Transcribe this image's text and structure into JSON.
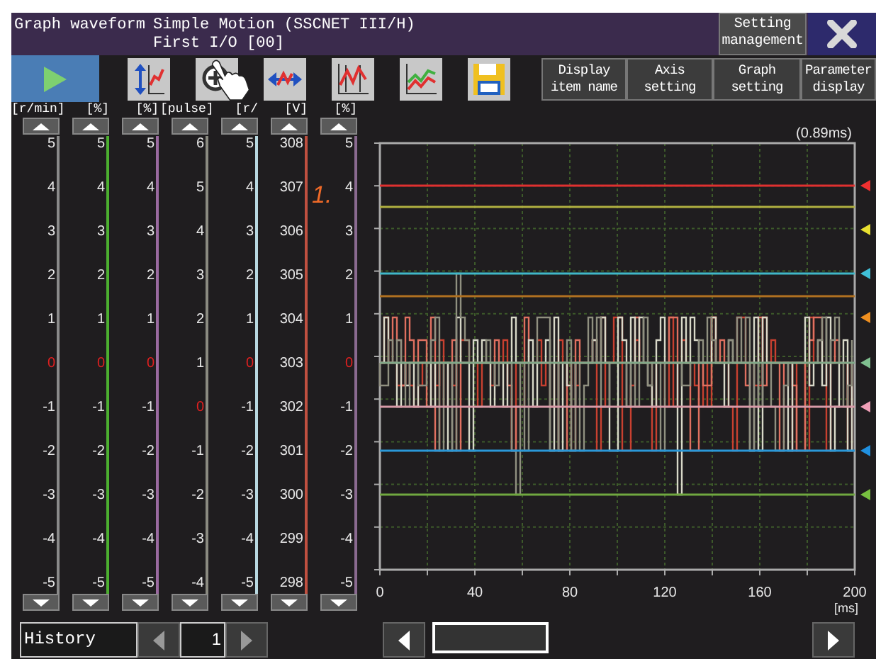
{
  "title_bar": {
    "title": "Graph waveform",
    "subtitle_lines": [
      "Simple Motion (SSCNET III/H)",
      "First I/O [00]"
    ],
    "setting_button": "Setting management"
  },
  "toolbar": {
    "text_buttons": [
      "Display item name",
      "Axis setting",
      "Graph setting",
      "Parameter display"
    ]
  },
  "step_label": "1.",
  "axes": [
    {
      "unit": "[r/min]",
      "color": "#8a8a8a",
      "ticks": [
        {
          "label": "5",
          "highlighted": false
        },
        {
          "label": "4",
          "highlighted": false
        },
        {
          "label": "3",
          "highlighted": false
        },
        {
          "label": "2",
          "highlighted": false
        },
        {
          "label": "1",
          "highlighted": false
        },
        {
          "label": "0",
          "highlighted": true
        },
        {
          "label": "-1",
          "highlighted": false
        },
        {
          "label": "-2",
          "highlighted": false
        },
        {
          "label": "-3",
          "highlighted": false
        },
        {
          "label": "-4",
          "highlighted": false
        },
        {
          "label": "-5",
          "highlighted": false
        }
      ]
    },
    {
      "unit": "[%]",
      "color": "#4caf30",
      "ticks": [
        {
          "label": "5",
          "highlighted": false
        },
        {
          "label": "4",
          "highlighted": false
        },
        {
          "label": "3",
          "highlighted": false
        },
        {
          "label": "2",
          "highlighted": false
        },
        {
          "label": "1",
          "highlighted": false
        },
        {
          "label": "0",
          "highlighted": true
        },
        {
          "label": "-1",
          "highlighted": false
        },
        {
          "label": "-2",
          "highlighted": false
        },
        {
          "label": "-3",
          "highlighted": false
        },
        {
          "label": "-4",
          "highlighted": false
        },
        {
          "label": "-5",
          "highlighted": false
        }
      ]
    },
    {
      "unit": "[%]",
      "color": "#9a6aa0",
      "ticks": [
        {
          "label": "5",
          "highlighted": false
        },
        {
          "label": "4",
          "highlighted": false
        },
        {
          "label": "3",
          "highlighted": false
        },
        {
          "label": "2",
          "highlighted": false
        },
        {
          "label": "1",
          "highlighted": false
        },
        {
          "label": "0",
          "highlighted": true
        },
        {
          "label": "-1",
          "highlighted": false
        },
        {
          "label": "-2",
          "highlighted": false
        },
        {
          "label": "-3",
          "highlighted": false
        },
        {
          "label": "-4",
          "highlighted": false
        },
        {
          "label": "-5",
          "highlighted": false
        }
      ]
    },
    {
      "unit": "[pulse]",
      "color": "#8a8a80",
      "ticks": [
        {
          "label": "6",
          "highlighted": false
        },
        {
          "label": "5",
          "highlighted": false
        },
        {
          "label": "4",
          "highlighted": false
        },
        {
          "label": "3",
          "highlighted": false
        },
        {
          "label": "2",
          "highlighted": false
        },
        {
          "label": "1",
          "highlighted": false
        },
        {
          "label": "0",
          "highlighted": true
        },
        {
          "label": "-1",
          "highlighted": false
        },
        {
          "label": "-2",
          "highlighted": false
        },
        {
          "label": "-3",
          "highlighted": false
        },
        {
          "label": "-4",
          "highlighted": false
        }
      ]
    },
    {
      "unit": "[r/",
      "color": "#b8d8e0",
      "ticks": [
        {
          "label": "5",
          "highlighted": false
        },
        {
          "label": "4",
          "highlighted": false
        },
        {
          "label": "3",
          "highlighted": false
        },
        {
          "label": "2",
          "highlighted": false
        },
        {
          "label": "1",
          "highlighted": false
        },
        {
          "label": "0",
          "highlighted": true
        },
        {
          "label": "-1",
          "highlighted": false
        },
        {
          "label": "-2",
          "highlighted": false
        },
        {
          "label": "-3",
          "highlighted": false
        },
        {
          "label": "-4",
          "highlighted": false
        },
        {
          "label": "-5",
          "highlighted": false
        }
      ]
    },
    {
      "unit": "[V]",
      "color": "#c05040",
      "ticks": [
        {
          "label": "308",
          "highlighted": false
        },
        {
          "label": "307",
          "highlighted": false
        },
        {
          "label": "306",
          "highlighted": false
        },
        {
          "label": "305",
          "highlighted": false
        },
        {
          "label": "304",
          "highlighted": false
        },
        {
          "label": "303",
          "highlighted": false
        },
        {
          "label": "302",
          "highlighted": false
        },
        {
          "label": "301",
          "highlighted": false
        },
        {
          "label": "300",
          "highlighted": false
        },
        {
          "label": "299",
          "highlighted": false
        },
        {
          "label": "298",
          "highlighted": false
        }
      ]
    },
    {
      "unit": "[%]",
      "color": "#8a6a90",
      "ticks": [
        {
          "label": "5",
          "highlighted": false
        },
        {
          "label": "4",
          "highlighted": false
        },
        {
          "label": "3",
          "highlighted": false
        },
        {
          "label": "2",
          "highlighted": false
        },
        {
          "label": "1",
          "highlighted": false
        },
        {
          "label": "0",
          "highlighted": true
        },
        {
          "label": "-1",
          "highlighted": false
        },
        {
          "label": "-2",
          "highlighted": false
        },
        {
          "label": "-3",
          "highlighted": false
        },
        {
          "label": "-4",
          "highlighted": false
        },
        {
          "label": "-5",
          "highlighted": false
        }
      ]
    }
  ],
  "graph": {
    "time_label": "(0.89ms)",
    "x_labels": [
      "0",
      "40",
      "80",
      "120",
      "160",
      "200"
    ],
    "x_unit": "[ms]",
    "level_lines": [
      {
        "color": "#e03030"
      },
      {
        "color": "#b0b040"
      },
      {
        "color": "#40b8c8"
      },
      {
        "color": "#b07020"
      },
      {
        "color": "#80a888"
      },
      {
        "color": "#d89aa8"
      },
      {
        "color": "#2a98d8"
      },
      {
        "color": "#70a840"
      }
    ],
    "markers": [
      {
        "color": "#f03030"
      },
      {
        "color": "#e8e030"
      },
      {
        "color": "#40c0d8"
      },
      {
        "color": "#f09020"
      },
      {
        "color": "#80c090"
      },
      {
        "color": "#f0a0b8"
      },
      {
        "color": "#2090e0"
      },
      {
        "color": "#78c040"
      }
    ]
  },
  "history": {
    "label": "History",
    "value": "1"
  }
}
